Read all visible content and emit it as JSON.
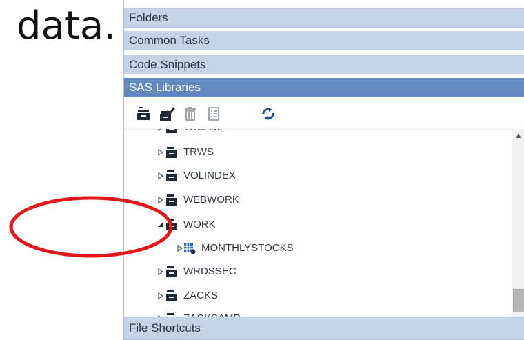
{
  "slide": {
    "word": "data."
  },
  "sections": {
    "folders": "Folders",
    "common_tasks": "Common Tasks",
    "code_snippets": "Code Snippets",
    "sas_libraries": "SAS Libraries",
    "file_shortcuts": "File Shortcuts"
  },
  "toolbar": {
    "buttons": [
      {
        "name": "new-library",
        "icon": "library-add-icon"
      },
      {
        "name": "properties",
        "icon": "library-edit-icon"
      },
      {
        "name": "delete",
        "icon": "trash-icon"
      },
      {
        "name": "view-details",
        "icon": "list-icon"
      },
      {
        "name": "refresh",
        "icon": "refresh-icon"
      }
    ]
  },
  "tree": {
    "items": [
      {
        "label": "TRSAMP",
        "expanded": false,
        "level": 0,
        "icon": "library-icon"
      },
      {
        "label": "TRWS",
        "expanded": false,
        "level": 0,
        "icon": "library-icon"
      },
      {
        "label": "VOLINDEX",
        "expanded": false,
        "level": 0,
        "icon": "library-icon"
      },
      {
        "label": "WEBWORK",
        "expanded": false,
        "level": 0,
        "icon": "library-icon"
      },
      {
        "label": "WORK",
        "expanded": true,
        "level": 0,
        "icon": "library-icon"
      },
      {
        "label": "MONTHLYSTOCKS",
        "expanded": false,
        "level": 1,
        "icon": "table-icon"
      },
      {
        "label": "WRDSSEC",
        "expanded": false,
        "level": 0,
        "icon": "library-icon"
      },
      {
        "label": "ZACKS",
        "expanded": false,
        "level": 0,
        "icon": "library-icon"
      },
      {
        "label": "ZACKSAMP",
        "expanded": false,
        "level": 0,
        "icon": "library-icon"
      }
    ]
  },
  "colors": {
    "header_bg": "#c4d3e6",
    "header_active_bg": "#6289bd",
    "icon_dark": "#1f2a36",
    "annotation_red": "#e3161b"
  }
}
